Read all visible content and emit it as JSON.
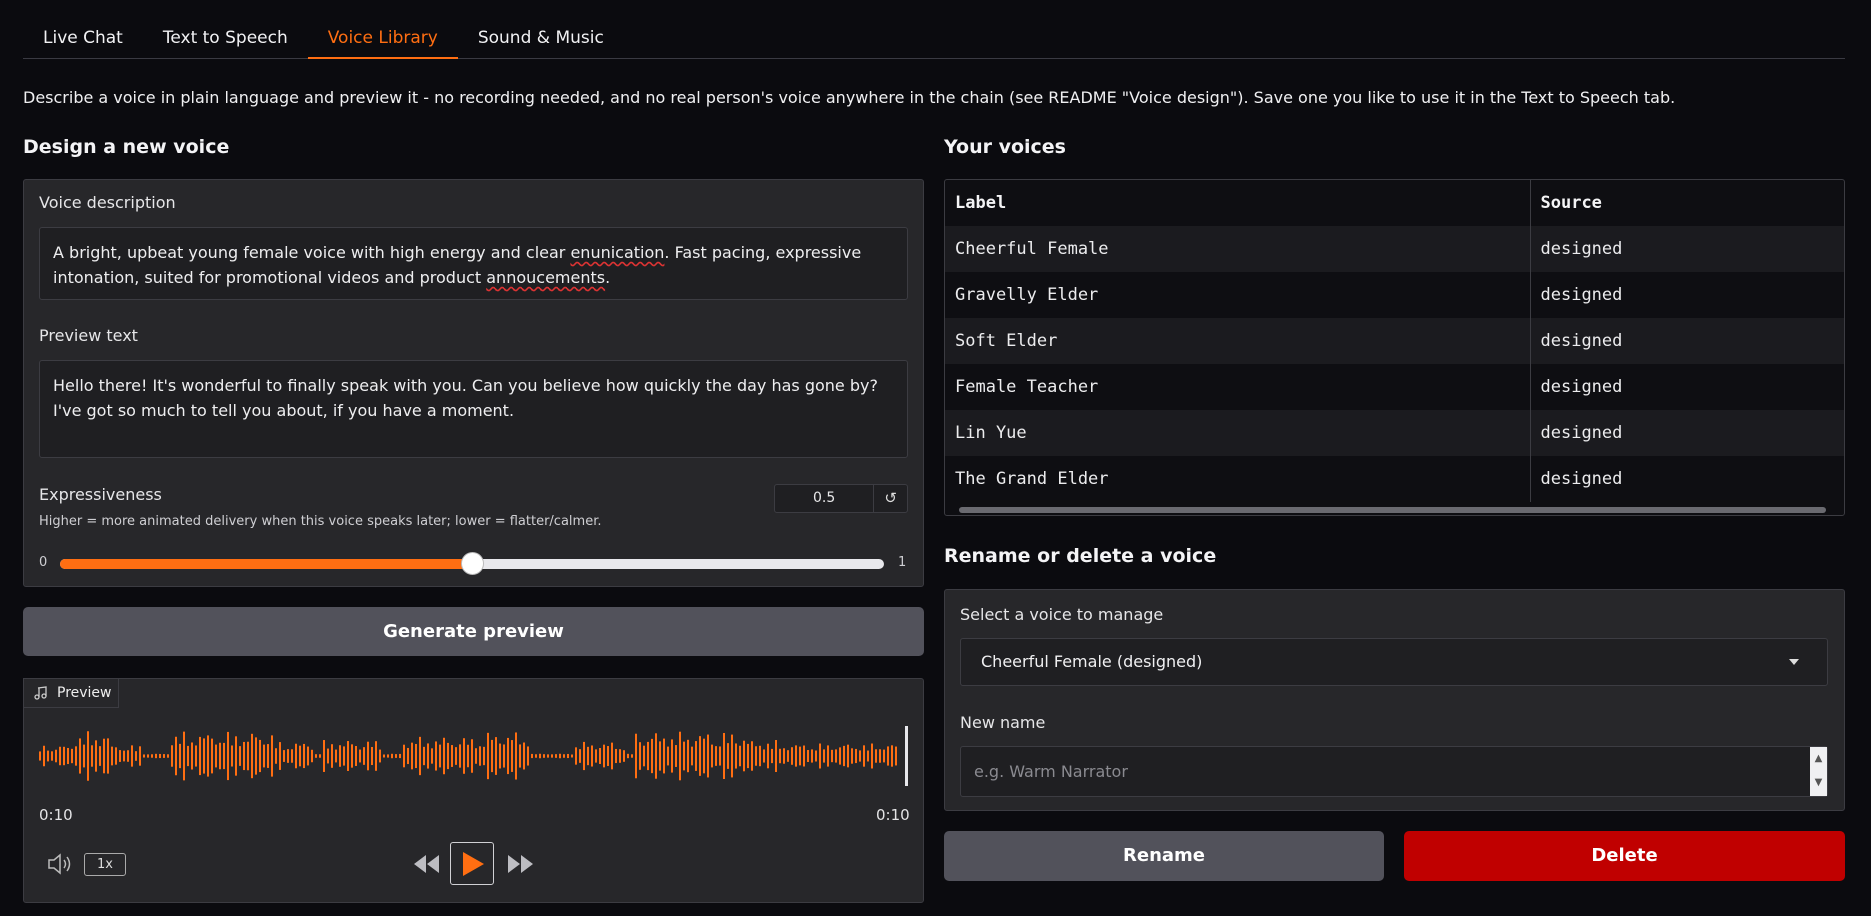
{
  "tabs": [
    "Live Chat",
    "Text to Speech",
    "Voice Library",
    "Sound & Music"
  ],
  "active_tab": "Voice Library",
  "description": "Describe a voice in plain language and preview it - no recording needed, and no real person's voice anywhere in the chain (see README \"Voice design\"). Save one you like to use it in the Text to Speech tab.",
  "design": {
    "heading": "Design a new voice",
    "voice_description_label": "Voice description",
    "voice_description": {
      "before": "A bright, upbeat young female voice with high energy and clear ",
      "misspelled1": "enunication",
      "middle": ". Fast pacing, expressive intonation, suited for promotional videos and product ",
      "misspelled2": "annoucements",
      "after": "."
    },
    "preview_text_label": "Preview text",
    "preview_text": "Hello there! It's wonderful to finally speak with you. Can you believe how quickly the day has gone by? I've got so much to tell you about, if you have a moment.",
    "expressiveness_label": "Expressiveness",
    "expressiveness_hint": "Higher = more animated delivery when this voice speaks later; lower = flatter/calmer.",
    "expressiveness_value": "0.5",
    "slider_min": "0",
    "slider_max": "1",
    "slider_fraction": 0.5,
    "generate_button": "Generate preview",
    "reset_icon": "↺"
  },
  "preview": {
    "badge": "Preview",
    "time_left": "0:10",
    "time_right": "0:10",
    "playback_rate": "1x",
    "waveform_color": "#ff6e12"
  },
  "voices": {
    "heading": "Your voices",
    "columns": [
      "Label",
      "Source"
    ],
    "rows": [
      [
        "Cheerful Female",
        "designed"
      ],
      [
        "Gravelly Elder",
        "designed"
      ],
      [
        "Soft Elder",
        "designed"
      ],
      [
        "Female Teacher",
        "designed"
      ],
      [
        "Lin Yue",
        "designed"
      ],
      [
        "The Grand Elder",
        "designed"
      ]
    ]
  },
  "manage": {
    "heading": "Rename or delete a voice",
    "select_label": "Select a voice to manage",
    "selected": "Cheerful Female (designed)",
    "new_name_label": "New name",
    "new_name_placeholder": "e.g. Warm Narrator",
    "rename_button": "Rename",
    "delete_button": "Delete"
  },
  "colors": {
    "accent": "#ff6e12",
    "danger": "#c00000",
    "panel": "#27272a"
  }
}
